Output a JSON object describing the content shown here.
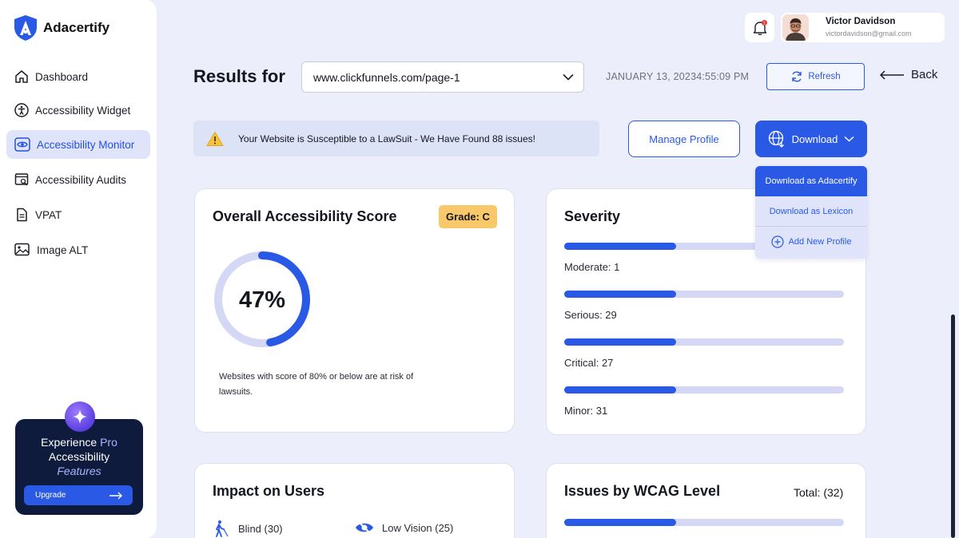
{
  "brand": {
    "name": "Adacertify"
  },
  "sidebar": {
    "items": [
      {
        "label": "Dashboard",
        "icon": "home-icon"
      },
      {
        "label": "Accessibility Widget",
        "icon": "accessibility-icon"
      },
      {
        "label": "Accessibility Monitor",
        "icon": "eye-icon",
        "active": true
      },
      {
        "label": "Accessibility Audits",
        "icon": "audit-icon"
      },
      {
        "label": "VPAT",
        "icon": "document-icon"
      },
      {
        "label": "Image ALT",
        "icon": "image-icon"
      }
    ],
    "promo": {
      "line1_a": "Experience ",
      "line1_b": "Pro",
      "line2": "Accessibility",
      "line3": "Features",
      "button": "Upgrade"
    }
  },
  "user": {
    "name": "Victor Davidson",
    "email": "victordavidson@gmail.com",
    "notification_count": "1"
  },
  "header": {
    "title": "Results for",
    "url": "www.clickfunnels.com/page-1",
    "timestamp": "JANUARY 13, 20234:55:09 PM",
    "refresh_label": "Refresh",
    "back_label": "Back"
  },
  "alert": {
    "text": "Your Website is Susceptible to a LawSuit - We Have Found 88 issues!"
  },
  "actions": {
    "manage_label": "Manage Profile",
    "download_label": "Download",
    "dropdown": [
      "Download as Adacertify",
      "Download as Lexicon",
      "Add New Profile"
    ]
  },
  "score_card": {
    "title": "Overall Accessibility Score",
    "grade": "Grade: C",
    "score_text": "47%",
    "score_value": 0.47,
    "note": "Websites with score of 80% or below are at risk of lawsuits."
  },
  "severity_card": {
    "title": "Severity",
    "rows": [
      {
        "label": "Moderate: 1",
        "fill": 0.4
      },
      {
        "label": "Serious: 29",
        "fill": 0.4
      },
      {
        "label": "Critical: 27",
        "fill": 0.4
      },
      {
        "label": "Minor: 31",
        "fill": 0.4
      }
    ]
  },
  "impact_card": {
    "title": "Impact on Users",
    "items": [
      {
        "label": "Blind (30)",
        "icon": "blind-person-icon"
      },
      {
        "label": "Low Vision (25)",
        "icon": "low-vision-icon"
      }
    ]
  },
  "wcag_card": {
    "title": "Issues by WCAG Level",
    "total": "Total: (32)",
    "bar_fill": 0.4
  },
  "colors": {
    "accent": "#2a59e6",
    "grade": "#f9c86a",
    "track": "#d5d8f5",
    "promo_bg": "#0f1b3d"
  }
}
